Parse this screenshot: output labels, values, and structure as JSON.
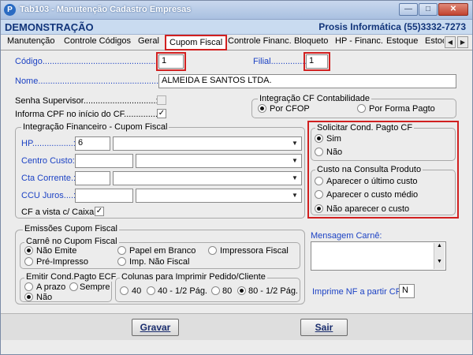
{
  "window": {
    "title": "Tab103 - Manutenção Cadastro Empresas",
    "minimize_icon": "minimize-icon",
    "maximize_icon": "maximize-icon",
    "close_icon": "close-icon"
  },
  "header": {
    "left": "DEMONSTRAÇÃO",
    "right": "Prosis Informática (55)3332-7273"
  },
  "tabs": [
    "Manutenção",
    "Controle Códigos",
    "Geral",
    "Cupom Fiscal",
    "Controle Financ.",
    "Bloqueto",
    "HP - Financ.",
    "Estoque",
    "Estoq"
  ],
  "active_tab": "Cupom Fiscal",
  "form": {
    "codigo_label": "Código......................................................:",
    "codigo_value": "1",
    "filial_label": "Filial...............:",
    "filial_value": "1",
    "nome_label": "Nome..........................................................:",
    "nome_value": "ALMEIDA E SANTOS LTDA.",
    "senha_label": "Senha Supervisor..............................:",
    "cpf_label": "Informa CPF no início do CF................:",
    "integ_cf": {
      "title": "Integração CF Contabilidade",
      "opt1": "Por CFOP",
      "opt2": "Por Forma Pagto"
    },
    "integ_fin": {
      "title": "Integração Financeiro - Cupom Fiscal",
      "hp_label": "HP.................:",
      "hp_value": "6",
      "centro_label": "Centro Custo:",
      "cta_label": "Cta Corrente.:",
      "ccu_label": "CCU Juros....:",
      "cf_vista_label": "CF a vista c/ Caixa"
    },
    "solicitar": {
      "title": "Solicitar Cond. Pagto CF",
      "opt1": "Sim",
      "opt2": "Não"
    },
    "custo": {
      "title": "Custo na Consulta Produto",
      "opt1": "Aparecer o último custo",
      "opt2": "Aparecer o custo médio",
      "opt3": "Não aparecer o custo"
    },
    "emissoes": {
      "title": "Emissões Cupom Fiscal",
      "carne": {
        "title": "Carnê no Cupom Fiscal",
        "opts": [
          "Não Emite",
          "Papel em Branco",
          "Impressora Fiscal",
          "Pré-Impresso",
          "Imp. Não Fiscal"
        ]
      },
      "emitir": {
        "title": "Emitir Cond.Pagto ECF",
        "opts": [
          "A prazo",
          "Sempre",
          "Não"
        ]
      },
      "colunas": {
        "title": "Colunas para Imprimir Pedido/Cliente",
        "opts": [
          "40",
          "40 - 1/2 Pág.",
          "80",
          "80 - 1/2 Pág."
        ]
      }
    },
    "mensagem_label": "Mensagem Carnê:",
    "imprime_label": "Imprime NF a partir CF:",
    "imprime_value": "N"
  },
  "buttons": {
    "gravar": "Gravar",
    "sair": "Sair"
  },
  "colors": {
    "accent_blue": "#1c42c4",
    "highlight_red": "#d12020",
    "header_bg": "#c9dbf0"
  }
}
